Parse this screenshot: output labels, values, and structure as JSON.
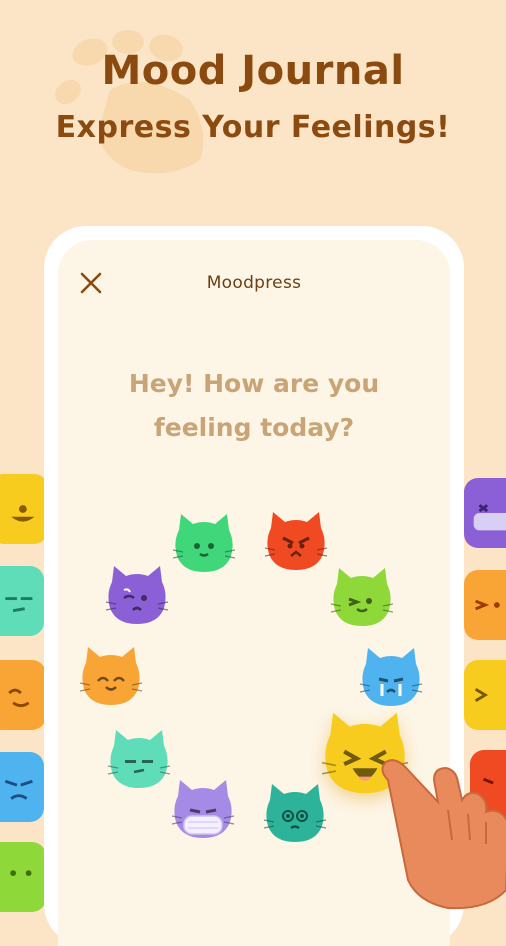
{
  "header": {
    "title": "Mood Journal",
    "subtitle": "Express Your Feelings!"
  },
  "app": {
    "title": "Moodpress",
    "close_icon": "close-icon",
    "question": "Hey! How are you feeling today?"
  },
  "colors": {
    "background": "#fbe5c6",
    "title_brown": "#8a4a10",
    "question_tan": "#c8a477",
    "screen_bg": "#fdf5e6"
  },
  "moods": [
    {
      "name": "green-calm-cat",
      "color": "#3fd77a",
      "face": "neutral"
    },
    {
      "name": "red-angry-cat",
      "color": "#f04a23",
      "face": "angry"
    },
    {
      "name": "lime-wink-cat",
      "color": "#8fd83a",
      "face": "wink"
    },
    {
      "name": "blue-crying-cat",
      "color": "#4fb3f0",
      "face": "cry"
    },
    {
      "name": "yellow-laughing-cat",
      "color": "#f8cc1e",
      "face": "laugh",
      "selected": true
    },
    {
      "name": "teal-dizzy-cat",
      "color": "#2cb39a",
      "face": "dizzy"
    },
    {
      "name": "lavender-masked-cat",
      "color": "#a58ae6",
      "face": "mask"
    },
    {
      "name": "mint-unimpressed-cat",
      "color": "#5fdcb8",
      "face": "meh"
    },
    {
      "name": "orange-content-cat",
      "color": "#f9a535",
      "face": "content"
    },
    {
      "name": "purple-sad-cat",
      "color": "#8b5fd6",
      "face": "sad"
    }
  ]
}
